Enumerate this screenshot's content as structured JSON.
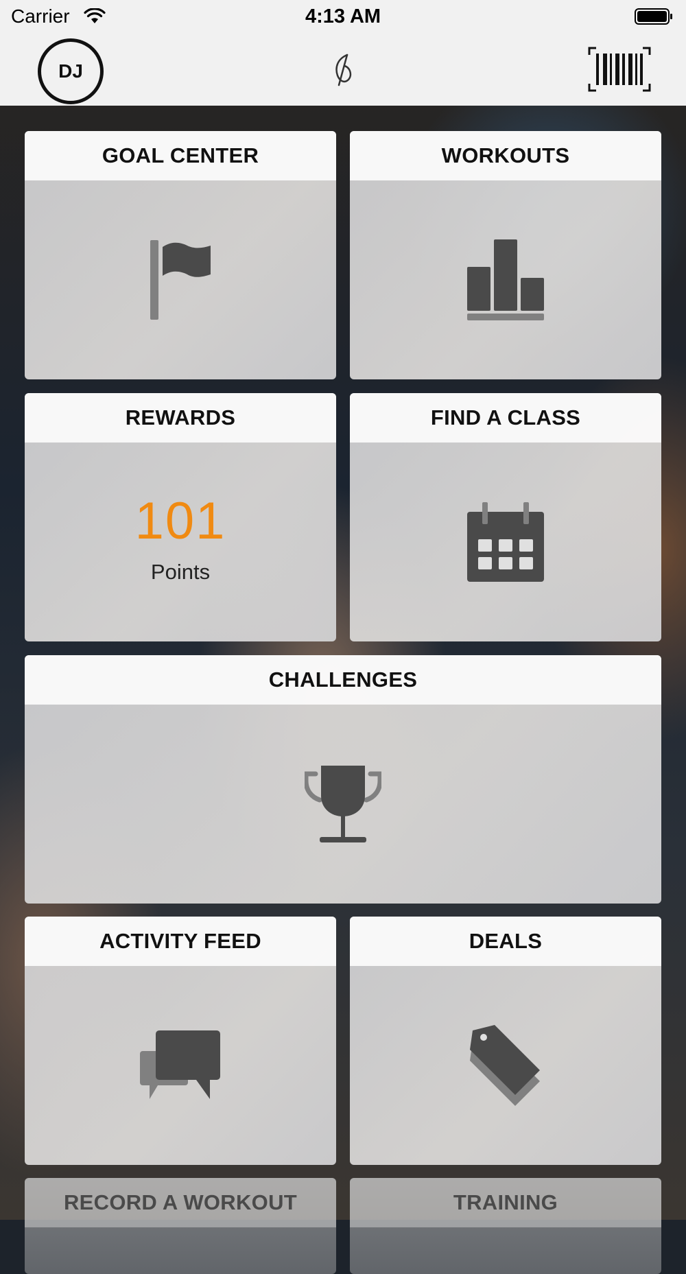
{
  "status_bar": {
    "carrier": "Carrier",
    "time": "4:13 AM"
  },
  "header": {
    "avatar_initials": "DJ",
    "logo_icon": "leaf-logo-icon",
    "barcode_icon": "barcode-icon"
  },
  "tiles": {
    "goal_center": {
      "title": "GOAL CENTER",
      "icon": "flag-icon"
    },
    "workouts": {
      "title": "WORKOUTS",
      "icon": "bar-chart-icon"
    },
    "rewards": {
      "title": "REWARDS",
      "points": "101",
      "points_label": "Points"
    },
    "find_a_class": {
      "title": "FIND A CLASS",
      "icon": "calendar-icon"
    },
    "challenges": {
      "title": "CHALLENGES",
      "icon": "trophy-icon"
    },
    "activity_feed": {
      "title": "ACTIVITY FEED",
      "icon": "chat-bubbles-icon"
    },
    "deals": {
      "title": "DEALS",
      "icon": "tag-icon"
    },
    "record_a_workout": {
      "title": "RECORD A WORKOUT"
    },
    "training": {
      "title": "TRAINING"
    }
  },
  "colors": {
    "accent_orange": "#f08a12",
    "icon_dark": "#4a4a4a",
    "icon_mid": "#808080"
  }
}
